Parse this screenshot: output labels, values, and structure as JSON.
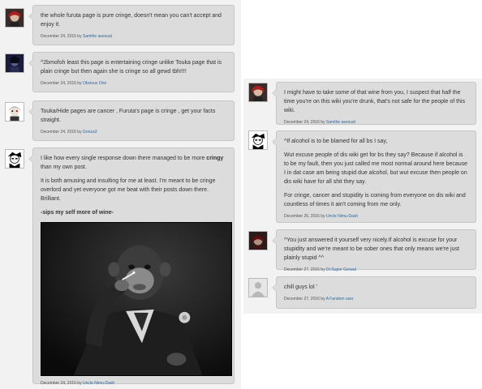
{
  "left_column": [
    {
      "text": "the whole furuta page is pure cringe, doesn't mean you can't accept and enjoy it.",
      "date": "December 24, 2016 by",
      "user": "Samthe asexual"
    },
    {
      "text": "^2bmofoh least this page is entertaining cringe unlike Touka page that is plain cringe but then again she is cringe so all gewd tbh!!!!",
      "date": "December 24, 2016 by",
      "user": "Obvious One"
    },
    {
      "text": "Touka/Hide pages are cancer , Furuta's page is cringe , get your facts straight.",
      "date": "December 24, 2016 by",
      "user": "Gonza3"
    },
    {
      "p1_before": "I like how every single response down there managed to be more ",
      "p1_bold": "cringy",
      "p1_after": " than my own post.",
      "p2": "It is both amusing and insulting for me at least. I'm meant to be cringe overlord and yet everyone got me beat with their posts down there. Brilliant.",
      "p3": "-sips my self more of wine-",
      "date": "December 24, 2016 by",
      "user": "Uncle Nimu-Dash"
    }
  ],
  "right_column": [
    {
      "text": "I might have to take some of that wine from you, I suspect that half the time you're on this wiki you're drunk, that's not safe for the people of this wiki.",
      "date": "December 24, 2016 by",
      "user": "Samthe asexual"
    },
    {
      "p1": "^If alcohol is to be blamed for all bs I say,",
      "p2": "Wut excuse people of dis wiki get for bs they say? Because if alcohol is to be my fault, then you just called me most normal around here because I in dat case am being stupid due alcohol, but wut excuse then people on dis wiki have for all shit they say.",
      "p3": "For cringe, cancer and stupidity is coming from everyone on dis wiki and countless of times it ain't coming from me only.",
      "date": "December 26, 2016 by",
      "user": "Uncle Nimu-Dash"
    },
    {
      "text": "^You just answered it yourself very nicely.If alcohol is excuse for your stupidity and we're meant to be sober ones that only means we're just plainly stupid ^^",
      "date": "December 27, 2016 by",
      "user": "Dr.Super Gerwal"
    },
    {
      "text": "chill guys lol '",
      "date": "December 27, 2016 by",
      "user": "A Fandom user"
    }
  ],
  "icons": {
    "avatar_1": "red-haired-character-avatar",
    "avatar_2": "dark-character-avatar",
    "avatar_3": "white-haired-character-avatar",
    "avatar_4": "black-white-character-avatar",
    "avatar_5": "red-haired-character-avatar",
    "avatar_6": "black-white-character-avatar",
    "avatar_7": "dark-red-character-avatar",
    "avatar_8": "default-user-silhouette-avatar",
    "image": "monkey-smoking-photo"
  },
  "colors": {
    "username_link": "#336699",
    "bubble": "#dcdcdc",
    "column_bg": "#f2f2f2"
  }
}
